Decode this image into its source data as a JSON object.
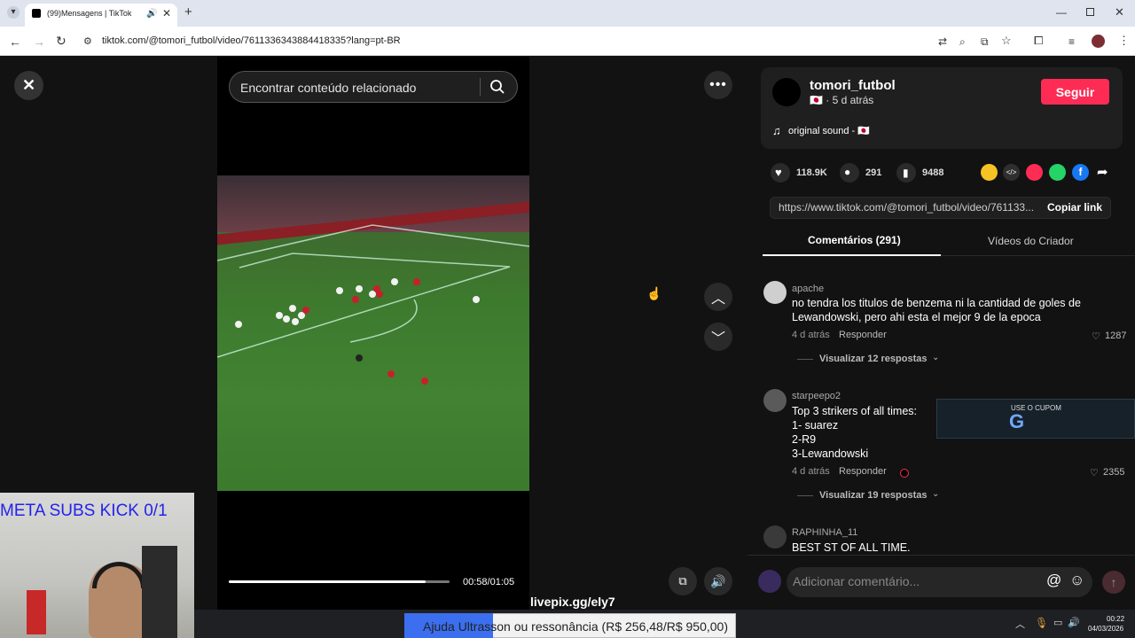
{
  "browser": {
    "tab_title": "(99)Mensagens | TikTok",
    "url": "tiktok.com/@tomori_futbol/video/7611336343884418335?lang=pt-BR"
  },
  "video": {
    "search_placeholder": "Encontrar conteúdo relacionado",
    "time": "00:58/01:05",
    "progress": 0.89
  },
  "author": {
    "username": "tomori_futbol",
    "meta": "🇯🇵 · 5 d atrás",
    "follow_label": "Seguir",
    "sound": "original sound - 🇯🇵"
  },
  "stats": {
    "likes": "118.9K",
    "comments": "291",
    "saves": "9488"
  },
  "share_colors": [
    "#f6c324",
    "#2f2f2f",
    "#fe2c55",
    "#25d366",
    "#1877f2"
  ],
  "link": {
    "url": "https://www.tiktok.com/@tomori_futbol/video/761133...",
    "copy_label": "Copiar link"
  },
  "tabs": {
    "comments": "Comentários (291)",
    "creator": "Vídeos do Criador"
  },
  "comments": [
    {
      "user": "apache",
      "text1": "no tendra los titulos de benzema ni la cantidad de goles de",
      "text2": "Lewandowski, pero ahi esta el mejor 9 de la epoca",
      "time": "4 d atrás",
      "reply": "Responder",
      "likes": "1287",
      "replies": "Visualizar 12 respostas"
    },
    {
      "user": "starpeepo2",
      "lines": [
        "Top 3 strikers of all times:",
        "1- suarez",
        "2-R9",
        "3-Lewandowski"
      ],
      "time": "4 d atrás",
      "reply": "Responder",
      "likes": "2355",
      "replies": "Visualizar 19 respostas"
    },
    {
      "user": "RAPHINHA_11",
      "text1": "BEST ST OF ALL TIME."
    }
  ],
  "comment_input_placeholder": "Adicionar comentário...",
  "overlays": {
    "webcam_text": "META SUBS KICK 0/1",
    "livepix": "livepix.gg/ely7",
    "donation": "Ajuda Ultrasson ou ressonância (R$ 256,48/R$ 950,00)",
    "promo": "USE O CUPOM",
    "promo_letter": "G"
  },
  "clock": {
    "time": "00:22",
    "date": "04/03/2026"
  }
}
